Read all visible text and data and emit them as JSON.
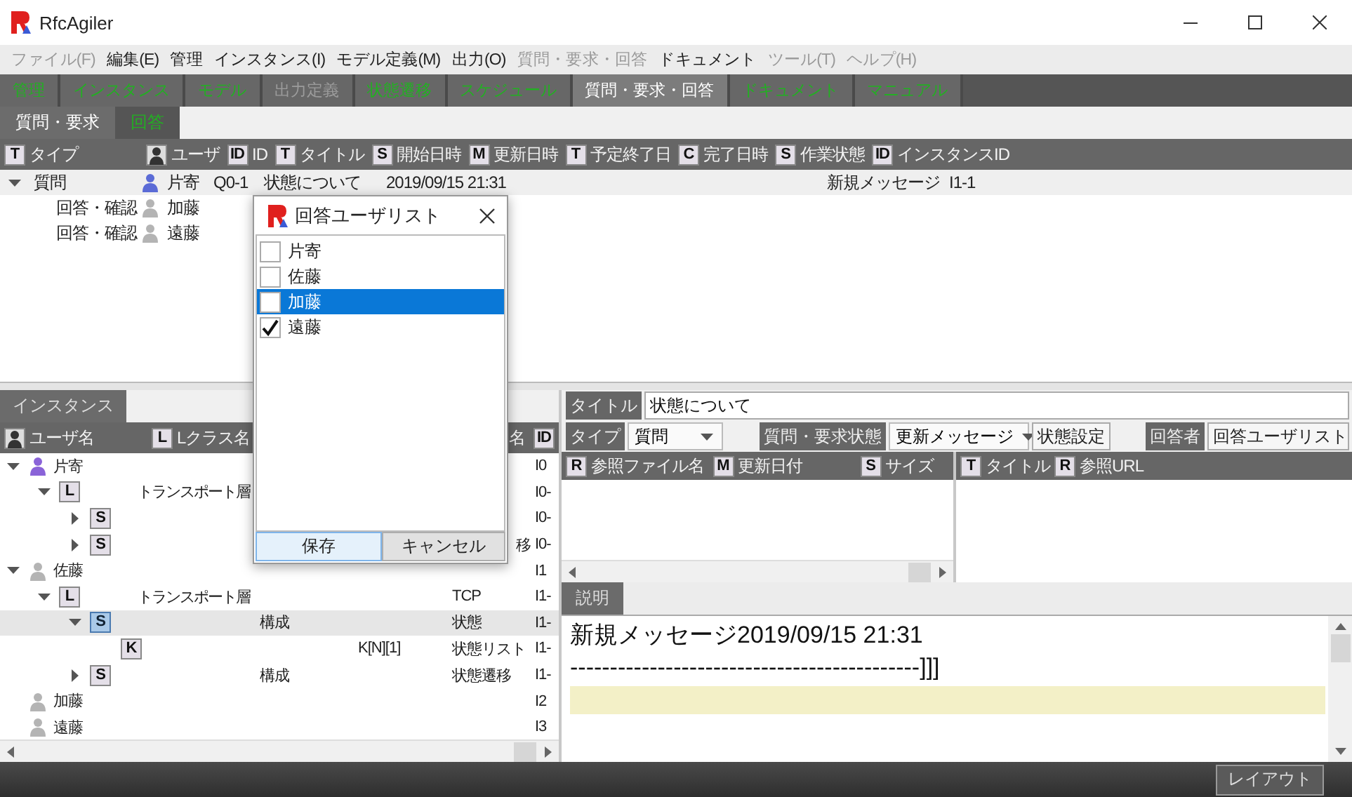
{
  "window": {
    "title": "RfcAgiler"
  },
  "menu": [
    {
      "label": "ファイル(F)",
      "disabled": true
    },
    {
      "label": "編集(E)",
      "disabled": false
    },
    {
      "label": "管理",
      "disabled": false
    },
    {
      "label": "インスタンス(I)",
      "disabled": false
    },
    {
      "label": "モデル定義(M)",
      "disabled": false
    },
    {
      "label": "出力(O)",
      "disabled": false
    },
    {
      "label": "質問・要求・回答",
      "disabled": true
    },
    {
      "label": "ドキュメント",
      "disabled": false
    },
    {
      "label": "ツール(T)",
      "disabled": true
    },
    {
      "label": "ヘルプ(H)",
      "disabled": true
    }
  ],
  "main_tabs": [
    {
      "label": "管理",
      "selected": false,
      "disabled": false
    },
    {
      "label": "インスタンス",
      "selected": false,
      "disabled": false
    },
    {
      "label": "モデル",
      "selected": false,
      "disabled": false
    },
    {
      "label": "出力定義",
      "selected": false,
      "disabled": true
    },
    {
      "label": "状態遷移",
      "selected": false,
      "disabled": false
    },
    {
      "label": "スケジュール",
      "selected": false,
      "disabled": false
    },
    {
      "label": "質問・要求・回答",
      "selected": true,
      "disabled": false
    },
    {
      "label": "ドキュメント",
      "selected": false,
      "disabled": false
    },
    {
      "label": "マニュアル",
      "selected": false,
      "disabled": false
    }
  ],
  "sub_tabs": [
    {
      "label": "質問・要求",
      "selected": true
    },
    {
      "label": "回答",
      "selected": false
    }
  ],
  "question_table": {
    "columns": [
      {
        "kind": "badge",
        "badge": "T",
        "label": "タイプ"
      },
      {
        "kind": "user",
        "label": "ユーザ"
      },
      {
        "kind": "badge",
        "badge": "ID",
        "label": "ID"
      },
      {
        "kind": "badge",
        "badge": "T",
        "label": "タイトル"
      },
      {
        "kind": "badge",
        "badge": "S",
        "label": "開始日時"
      },
      {
        "kind": "badge",
        "badge": "M",
        "label": "更新日時"
      },
      {
        "kind": "badge",
        "badge": "T",
        "label": "予定終了日"
      },
      {
        "kind": "badge",
        "badge": "C",
        "label": "完了日時"
      },
      {
        "kind": "badge",
        "badge": "S",
        "label": "作業状態"
      },
      {
        "kind": "badge",
        "badge": "ID",
        "label": "インスタンスID"
      }
    ],
    "rows": [
      {
        "type": "質問",
        "expanded": true,
        "selected": true,
        "user": {
          "name": "片寄",
          "color": "#5b6bd6"
        },
        "id": "Q0-1",
        "title": "状態について",
        "start": "2019/09/15 21:31",
        "status": "新規メッセージ",
        "instance_id": "I1-1",
        "children": [
          {
            "type": "回答・確認",
            "selected": false,
            "user": {
              "name": "加藤",
              "color": "#b4b4b4"
            }
          },
          {
            "type": "回答・確認",
            "selected": false,
            "user": {
              "name": "遠藤",
              "color": "#b4b4b4"
            }
          }
        ]
      }
    ]
  },
  "instance_panel": {
    "tab": "インスタンス",
    "columns": [
      {
        "kind": "user",
        "label": "ユーザ名"
      },
      {
        "kind": "badge",
        "badge": "L",
        "label": "Lクラス名"
      },
      {
        "kind": "plain",
        "label": "名"
      },
      {
        "kind": "badge",
        "badge": "ID"
      }
    ],
    "tree": [
      {
        "kind": "user",
        "name": "片寄",
        "color": "#8a63d8",
        "expanded": true,
        "selected": false,
        "id": "I0",
        "children": [
          {
            "kind": "badge",
            "badge": "L",
            "expanded": true,
            "selected": false,
            "lclass": "トランスポート層",
            "id": "I0-",
            "children": [
              {
                "kind": "badge",
                "badge": "S",
                "expanded": false,
                "selected": false,
                "id": "I0-"
              },
              {
                "kind": "badge",
                "badge": "S",
                "expanded": false,
                "selected": false,
                "column_5": "移",
                "clipped_left": true,
                "id": "I0-"
              }
            ]
          }
        ]
      },
      {
        "kind": "user",
        "name": "佐藤",
        "color": "#b4b4b4",
        "expanded": true,
        "selected": false,
        "id": "I1",
        "children": [
          {
            "kind": "badge",
            "badge": "L",
            "expanded": true,
            "selected": false,
            "lclass": "トランスポート層",
            "column_5": "TCP",
            "id": "I1-",
            "children": [
              {
                "kind": "badge",
                "badge": "S",
                "expanded": true,
                "selected": true,
                "column_3": "構成",
                "column_5": "状態",
                "id": "I1-",
                "children": [
                  {
                    "kind": "badge",
                    "badge": "K",
                    "selected": false,
                    "column_4": "K[N][1]",
                    "column_5": "状態リスト",
                    "id": "I1-"
                  }
                ]
              },
              {
                "kind": "badge",
                "badge": "S",
                "expanded": false,
                "selected": false,
                "column_3": "構成",
                "column_5": "状態遷移",
                "id": "I1-"
              }
            ]
          }
        ]
      },
      {
        "kind": "user",
        "name": "加藤",
        "color": "#b4b4b4",
        "selected": false,
        "id": "I2"
      },
      {
        "kind": "user",
        "name": "遠藤",
        "color": "#b4b4b4",
        "selected": false,
        "id": "I3"
      }
    ]
  },
  "detail": {
    "title_label": "タイトル",
    "title_value": "状態について",
    "type_label": "タイプ",
    "type_value": "質問",
    "state_label": "質問・要求状態",
    "state_value": "更新メッセージ",
    "state_button": "状態設定",
    "answerer_label": "回答者",
    "answerer_button": "回答ユーザリスト",
    "files_table": {
      "columns": [
        {
          "badge": "R",
          "label": "参照ファイル名"
        },
        {
          "badge": "M",
          "label": "更新日付"
        },
        {
          "badge": "S",
          "label": "サイズ"
        }
      ]
    },
    "links_table": {
      "columns": [
        {
          "badge": "T",
          "label": "タイトル"
        },
        {
          "badge": "R",
          "label": "参照URL"
        }
      ]
    },
    "description": {
      "tab": "説明",
      "lines": [
        "新規メッセージ2019/09/15 21:31",
        "--------------------------------------------]]]"
      ]
    }
  },
  "answer_dialog": {
    "title": "回答ユーザリスト",
    "items": [
      {
        "label": "片寄",
        "checked": false,
        "selected": false
      },
      {
        "label": "佐藤",
        "checked": false,
        "selected": false
      },
      {
        "label": "加藤",
        "checked": false,
        "selected": true
      },
      {
        "label": "遠藤",
        "checked": true,
        "selected": false
      }
    ],
    "buttons": [
      "保存",
      "キャンセル"
    ]
  },
  "status_bar": {
    "button": "レイアウト"
  }
}
